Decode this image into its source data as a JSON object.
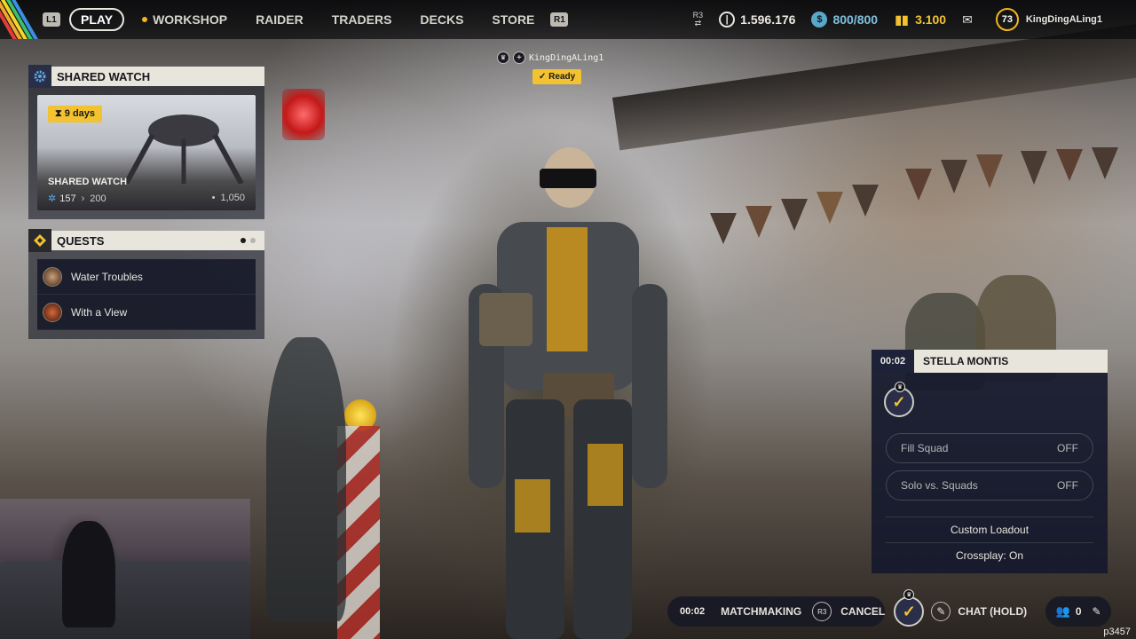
{
  "topbar": {
    "l1_hint": "L1",
    "r1_hint": "R1",
    "play_label": "PLAY",
    "nav_items": [
      "WORKSHOP",
      "RAIDER",
      "TRADERS",
      "DECKS",
      "STORE"
    ],
    "r3_hint": "R3",
    "currency_1": "1.596.176",
    "currency_2": "800/800",
    "currency_3": "3.100",
    "player_level": "73",
    "player_name": "KingDingALing1"
  },
  "shared_watch": {
    "header": "SHARED WATCH",
    "days_badge": "9 days",
    "card_title": "SHARED WATCH",
    "progress_current": "157",
    "progress_next": "200",
    "total": "1,050"
  },
  "quests": {
    "header": "QUESTS",
    "items": [
      "Water Troubles",
      "With a View"
    ]
  },
  "squad": {
    "leader_name": "KingDingALing1",
    "ready_label": "Ready"
  },
  "match_panel": {
    "timer": "00:02",
    "map_name": "STELLA MONTIS",
    "fill_squad_label": "Fill Squad",
    "fill_squad_value": "OFF",
    "solo_squads_label": "Solo vs. Squads",
    "solo_squads_value": "OFF",
    "custom_loadout_label": "Custom Loadout",
    "crossplay_label": "Crossplay: On"
  },
  "bottombar": {
    "timer": "00:02",
    "matchmaking_label": "MATCHMAKING",
    "r3_hint": "R3",
    "cancel_label": "CANCEL",
    "chat_label": "CHAT (HOLD)",
    "friends_count": "0"
  },
  "watermark": "p3457",
  "colors": {
    "accent_yellow": "#f2c230",
    "panel_header": "#e8e5dc",
    "panel_dark": "#1e2238",
    "currency_teal": "#5aa8c8"
  },
  "icons": {
    "shared_watch": "gear-icon",
    "quests": "diamond-icon",
    "currency_1": "coin-icon",
    "currency_2": "raider-token-icon",
    "currency_3": "credits-icon",
    "inbox": "envelope-icon",
    "friends": "friends-icon",
    "chat": "pencil-icon"
  }
}
